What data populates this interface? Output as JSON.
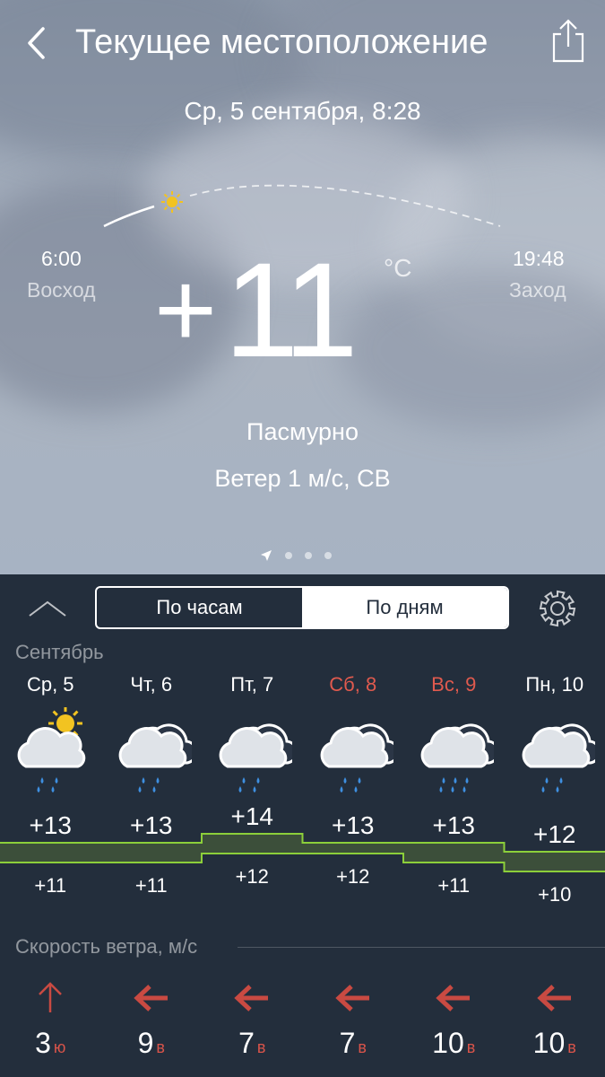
{
  "header": {
    "title": "Текущее местоположение",
    "datetime": "Ср, 5 сентября, 8:28"
  },
  "sun": {
    "sunrise_time": "6:00",
    "sunrise_label": "Восход",
    "sunset_time": "19:48",
    "sunset_label": "Заход"
  },
  "current": {
    "temp_sign": "+",
    "temp_value": "11",
    "unit": "°C",
    "condition": "Пасмурно",
    "wind": "Ветер 1 м/с, СВ"
  },
  "pager": {
    "total": 4,
    "active": 0
  },
  "tabs": {
    "hourly": "По часам",
    "daily": "По дням",
    "selected": "daily"
  },
  "month": "Сентябрь",
  "forecast": [
    {
      "day": "Ср, 5",
      "weekend": false,
      "icon": "cloud-sun-rain-icon",
      "max": "+13",
      "min": "+11"
    },
    {
      "day": "Чт, 6",
      "weekend": false,
      "icon": "cloud-rain-icon",
      "max": "+13",
      "min": "+11"
    },
    {
      "day": "Пт, 7",
      "weekend": false,
      "icon": "cloud-rain-icon",
      "max": "+14",
      "min": "+12"
    },
    {
      "day": "Сб, 8",
      "weekend": true,
      "icon": "cloud-rain-icon",
      "max": "+13",
      "min": "+12"
    },
    {
      "day": "Вс, 9",
      "weekend": true,
      "icon": "cloud-heavy-rain-icon",
      "max": "+13",
      "min": "+11"
    },
    {
      "day": "Пн, 10",
      "weekend": false,
      "icon": "cloud-rain-icon",
      "max": "+12",
      "min": "+10"
    }
  ],
  "wind_section": {
    "title": "Скорость ветра, м/с",
    "items": [
      {
        "speed": "3",
        "dir": "ю",
        "arrow": "arrow-up-icon"
      },
      {
        "speed": "9",
        "dir": "в",
        "arrow": "arrow-left-icon"
      },
      {
        "speed": "7",
        "dir": "в",
        "arrow": "arrow-left-icon"
      },
      {
        "speed": "7",
        "dir": "в",
        "arrow": "arrow-left-icon"
      },
      {
        "speed": "10",
        "dir": "в",
        "arrow": "arrow-left-icon"
      },
      {
        "speed": "10",
        "dir": "в",
        "arrow": "arrow-left-icon"
      }
    ]
  },
  "colors": {
    "panel_bg": "#232e3c",
    "weekend": "#e05a4e",
    "wind_arrow": "#c94a42",
    "temp_band_stroke": "#8ccf3a",
    "temp_band_fill": "#3c4f3a",
    "sun": "#f2c321",
    "rain": "#3e8fe0"
  }
}
